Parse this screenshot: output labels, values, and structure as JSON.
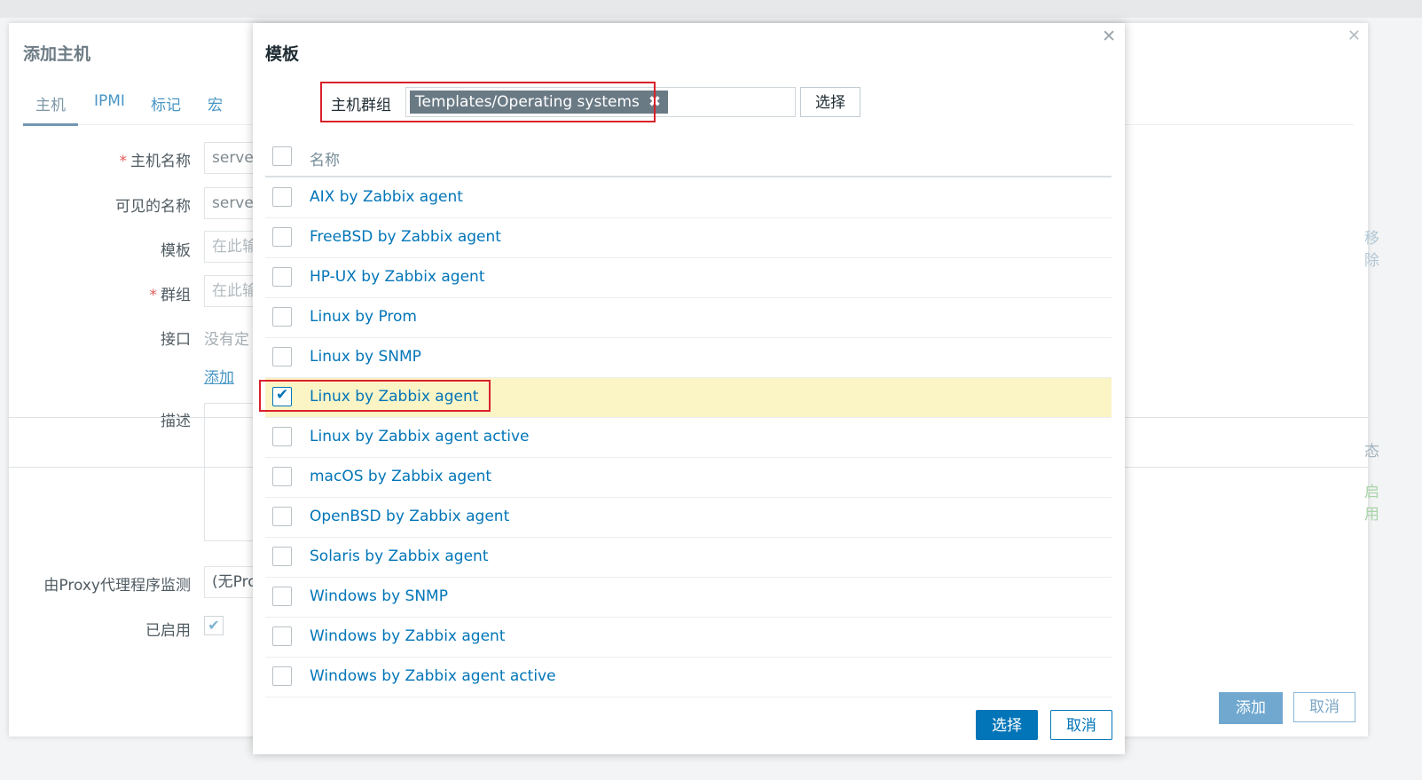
{
  "back_dialog": {
    "title": "添加主机",
    "tabs": [
      "主机",
      "IPMI",
      "标记",
      "宏"
    ],
    "labels": {
      "host_name": "主机名称",
      "visible_name": "可见的名称",
      "templates": "模板",
      "groups": "群组",
      "interfaces": "接口",
      "description": "描述",
      "proxy": "由Proxy代理程序监测",
      "enabled": "已启用"
    },
    "values": {
      "host_name": "server",
      "visible_name": "server",
      "templates_placeholder": "在此输",
      "groups_placeholder": "在此输",
      "interfaces_text": "没有定",
      "add_link": "添加",
      "proxy": "(无Pro"
    },
    "right_partial": [
      "移除",
      "态",
      "启用"
    ],
    "buttons": {
      "add": "添加",
      "cancel": "取消"
    }
  },
  "front_dialog": {
    "title": "模板",
    "host_group_label": "主机群组",
    "host_group_tag": "Templates/Operating systems",
    "select_button": "选择",
    "column_header": "名称",
    "templates": [
      {
        "name": "AIX by Zabbix agent",
        "checked": false
      },
      {
        "name": "FreeBSD by Zabbix agent",
        "checked": false
      },
      {
        "name": "HP-UX by Zabbix agent",
        "checked": false
      },
      {
        "name": "Linux by Prom",
        "checked": false
      },
      {
        "name": "Linux by SNMP",
        "checked": false
      },
      {
        "name": "Linux by Zabbix agent",
        "checked": true
      },
      {
        "name": "Linux by Zabbix agent active",
        "checked": false
      },
      {
        "name": "macOS by Zabbix agent",
        "checked": false
      },
      {
        "name": "OpenBSD by Zabbix agent",
        "checked": false
      },
      {
        "name": "Solaris by Zabbix agent",
        "checked": false
      },
      {
        "name": "Windows by SNMP",
        "checked": false
      },
      {
        "name": "Windows by Zabbix agent",
        "checked": false
      },
      {
        "name": "Windows by Zabbix agent active",
        "checked": false
      }
    ],
    "buttons": {
      "select": "选择",
      "cancel": "取消"
    }
  },
  "colors": {
    "accent": "#0275b8",
    "highlight": "#fbf4c5",
    "annotation": "#d9212a"
  }
}
